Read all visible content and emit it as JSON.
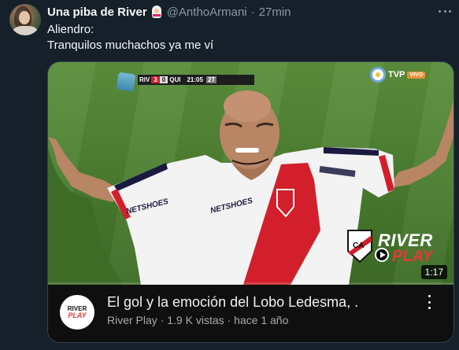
{
  "tweet": {
    "author_name": "Una piba de River",
    "author_emoji": "bride-emoji",
    "handle": "@AnthoArmani",
    "separator": "·",
    "time": "27min",
    "line1": "Aliendro:",
    "line2": "Tranquilos muchachos ya me ví"
  },
  "video": {
    "scoreboard": {
      "home": "RIV",
      "home_score": "3",
      "away_score": "0",
      "away": "QUI",
      "clock": "21:05",
      "status": "2T"
    },
    "broadcaster": "TVP",
    "live_badge": "VIVO",
    "shirt_sponsor": "NETSHOES",
    "watermark": {
      "line1": "RIVER",
      "line2": "PLAY"
    },
    "duration": "1:17"
  },
  "card": {
    "channel_logo": {
      "line1": "RIVER",
      "line2": "PLAY"
    },
    "title": "El gol y la emoción del Lobo Ledesma, .",
    "channel": "River Play",
    "views": "1.9 K vistas",
    "dot": "·",
    "age": "hace 1 año"
  },
  "colors": {
    "background": "#15202b",
    "card_background": "#0f0f0f",
    "river_red": "#d21f2b",
    "secondary_text": "#8b98a5"
  }
}
